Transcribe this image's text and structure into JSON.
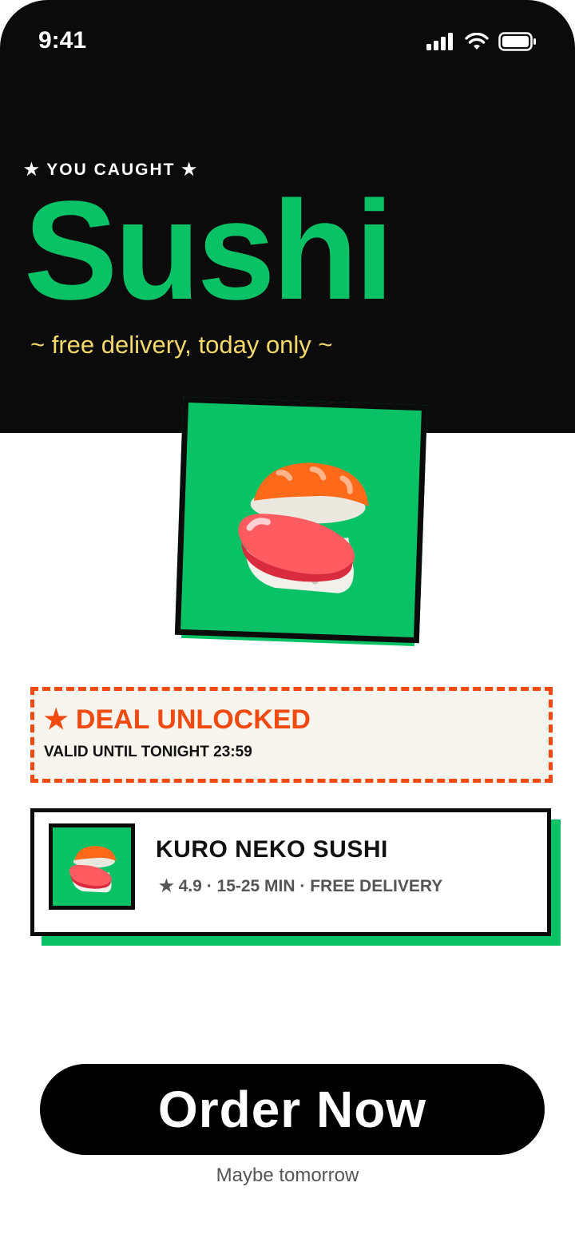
{
  "status_bar": {
    "time": "9:41",
    "icons": [
      "signal-icon",
      "wifi-icon",
      "battery-icon"
    ]
  },
  "hero": {
    "eyebrow": "★ YOU CAUGHT ★",
    "headline": "Sushi",
    "subline": "~ free delivery, today only ~",
    "image_icon": "sushi-icon"
  },
  "deal": {
    "title": "★ DEAL UNLOCKED",
    "validity": "VALID UNTIL TONIGHT 23:59"
  },
  "restaurant": {
    "name": "KURO NEKO SUSHI",
    "meta": "★ 4.9 · 15-25 MIN · FREE DELIVERY",
    "thumb_icon": "sushi-icon"
  },
  "actions": {
    "primary_label": "Order Now",
    "secondary_label": "Maybe tomorrow"
  },
  "colors": {
    "hero_bg": "#0b0b0b",
    "accent_green": "#0ac266",
    "deal_orange": "#f04a10",
    "subline_yellow": "#f5d86a"
  }
}
